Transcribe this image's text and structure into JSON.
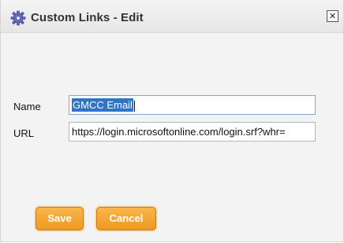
{
  "dialog": {
    "title": "Custom Links - Edit",
    "icon": "gear-icon",
    "close_glyph": "✕"
  },
  "form": {
    "name_label": "Name",
    "name_value": "GMCC Email",
    "url_label": "URL",
    "url_value": "https://login.microsoftonline.com/login.srf?whr="
  },
  "buttons": {
    "save": "Save",
    "cancel": "Cancel"
  },
  "colors": {
    "accent": "#f0a030",
    "selection": "#3074c6"
  }
}
